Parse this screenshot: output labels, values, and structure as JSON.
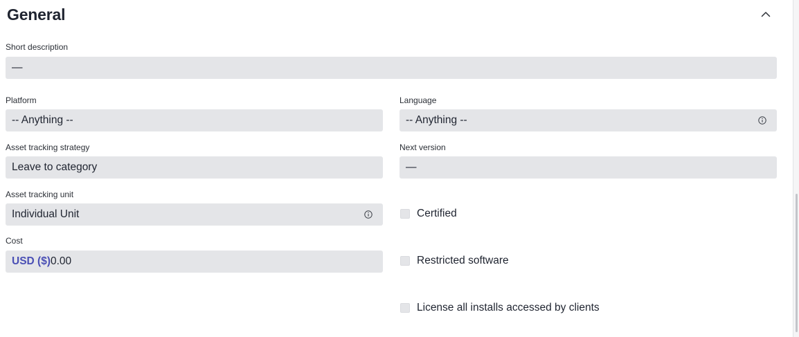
{
  "section": {
    "title": "General",
    "collapse_icon": "chevron-up-icon"
  },
  "fields": {
    "short_description": {
      "label": "Short description",
      "value": "—"
    },
    "platform": {
      "label": "Platform",
      "value": "-- Anything --"
    },
    "language": {
      "label": "Language",
      "value": "-- Anything --",
      "icon": "info-icon"
    },
    "asset_tracking_strategy": {
      "label": "Asset tracking strategy",
      "value": "Leave to category"
    },
    "next_version": {
      "label": "Next version",
      "value": "—"
    },
    "asset_tracking_unit": {
      "label": "Asset tracking unit",
      "value": "Individual Unit",
      "icon": "info-icon"
    },
    "cost": {
      "label": "Cost",
      "currency_prefix": "USD ($)",
      "value": "0.00"
    }
  },
  "checkboxes": {
    "certified": {
      "label": "Certified",
      "checked": false
    },
    "restricted_software": {
      "label": "Restricted software",
      "checked": false
    },
    "license_all_installs": {
      "label": "License all installs accessed by clients",
      "checked": false
    }
  },
  "colors": {
    "field_background": "#e4e5e8",
    "currency_prefix": "#4a4fb5",
    "text": "#1f2430"
  }
}
